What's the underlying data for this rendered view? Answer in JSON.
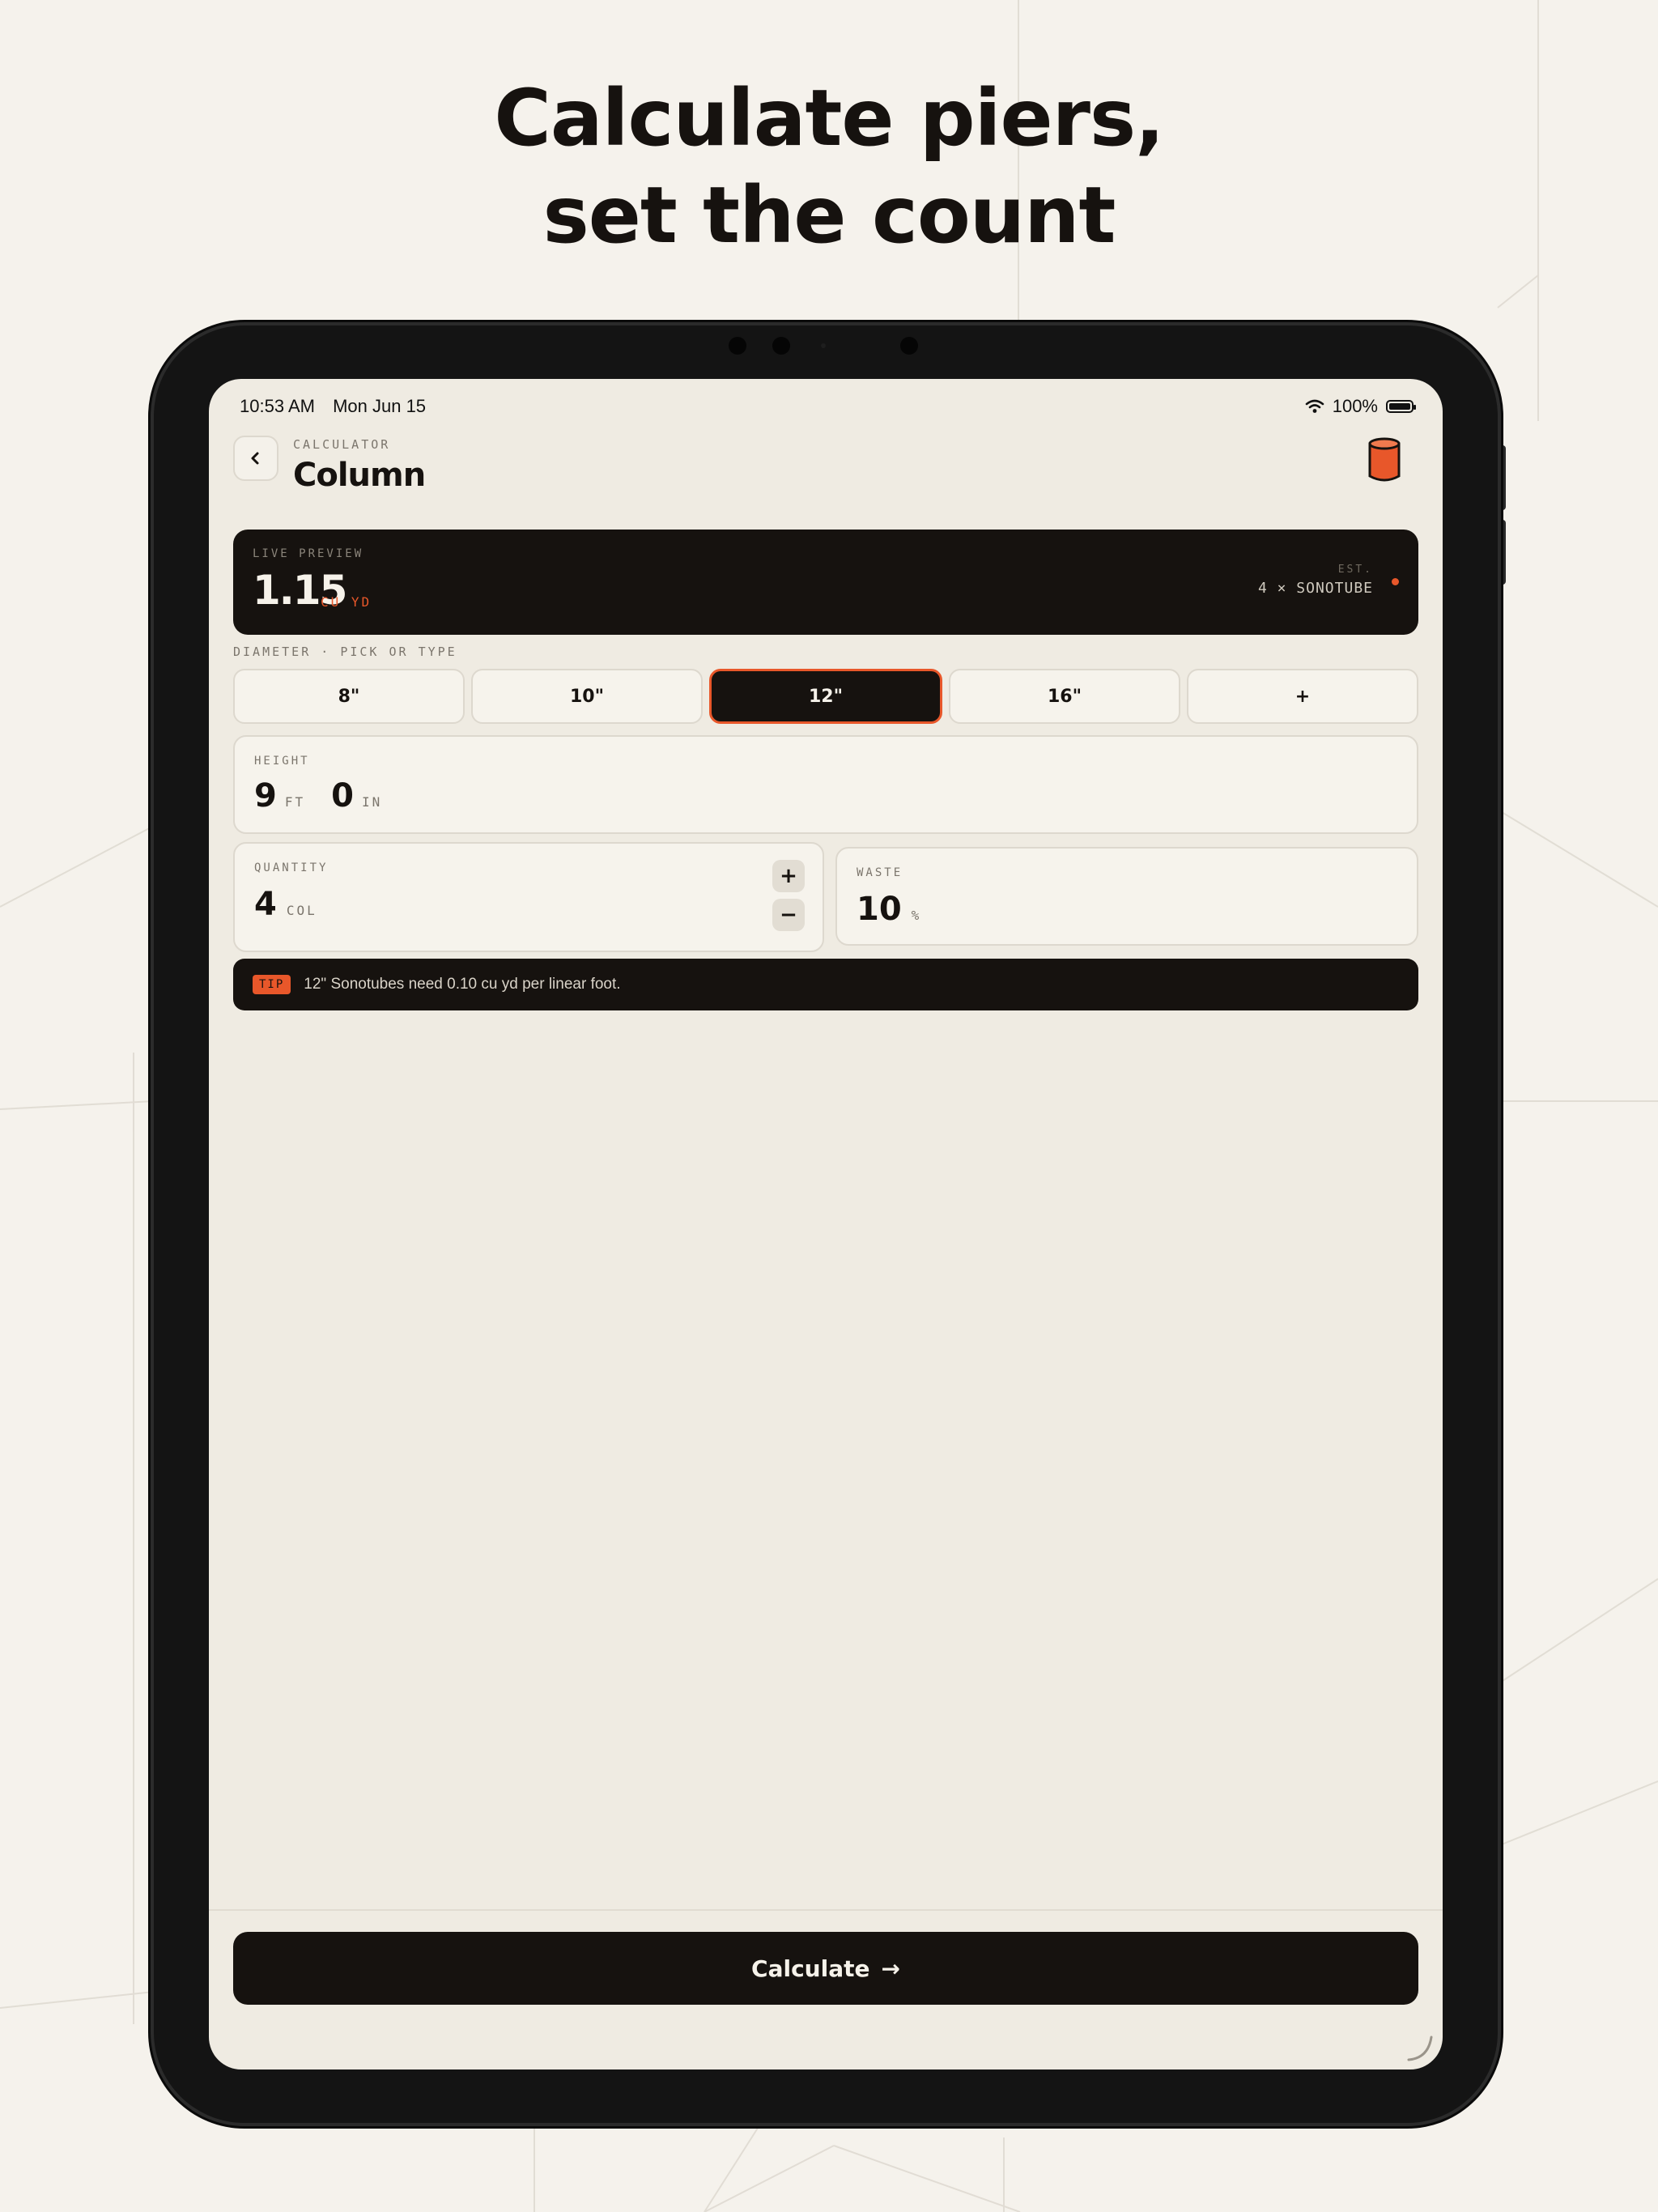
{
  "headline": {
    "line1": "Calculate piers,",
    "line2": "set the count"
  },
  "status_bar": {
    "time": "10:53 AM",
    "date": "Mon Jun 15",
    "battery": "100%"
  },
  "header": {
    "eyebrow": "CALCULATOR",
    "title": "Column"
  },
  "live_preview": {
    "label": "LIVE PREVIEW",
    "value": "1.15",
    "unit": "CU YD",
    "est_label": "EST.",
    "estimate": "4 × SONOTUBE"
  },
  "diameter": {
    "label": "DIAMETER · PICK OR TYPE",
    "options": [
      {
        "label": "8\"",
        "selected": false
      },
      {
        "label": "10\"",
        "selected": false
      },
      {
        "label": "12\"",
        "selected": true
      },
      {
        "label": "16\"",
        "selected": false
      },
      {
        "label": "+",
        "selected": false
      }
    ]
  },
  "height": {
    "label": "HEIGHT",
    "feet": "9",
    "feet_unit": "FT",
    "inches": "0",
    "inches_unit": "IN"
  },
  "quantity": {
    "label": "QUANTITY",
    "value": "4",
    "unit": "COL",
    "plus": "+",
    "minus": "−"
  },
  "waste": {
    "label": "WASTE",
    "value": "10",
    "unit": "%"
  },
  "tip": {
    "badge": "TIP",
    "text": "12\" Sonotubes need 0.10 cu yd per linear foot."
  },
  "calculate_button": {
    "label": "Calculate",
    "arrow": "→"
  },
  "colors": {
    "accent": "#e8572a",
    "dark": "#16120f",
    "surface": "#efebe2",
    "background": "#f5f2ec"
  }
}
